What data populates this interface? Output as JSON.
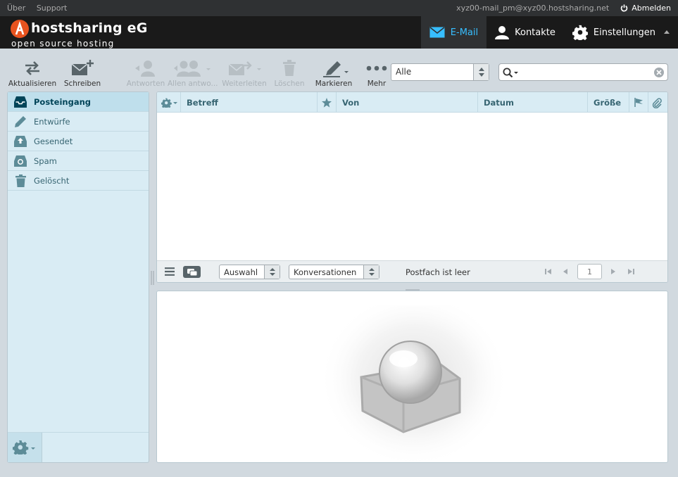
{
  "topline": {
    "links": [
      "Über",
      "Support"
    ],
    "username": "xyz00-mail_pm@xyz00.hostsharing.net",
    "logout_label": "Abmelden"
  },
  "header": {
    "brand": "hostsharing eG",
    "tagline": "open source hosting",
    "tasks": [
      {
        "label": "E-Mail",
        "icon": "mail-icon",
        "selected": true
      },
      {
        "label": "Kontakte",
        "icon": "user-icon",
        "selected": false
      },
      {
        "label": "Einstellungen",
        "icon": "gear-icon",
        "selected": false
      }
    ]
  },
  "toolbar": {
    "refresh": "Aktualisieren",
    "compose": "Schreiben",
    "reply": "Antworten",
    "reply_all": "Allen antwo...",
    "forward": "Weiterleiten",
    "delete": "Löschen",
    "mark": "Markieren",
    "more": "Mehr",
    "filter_value": "Alle",
    "search_value": ""
  },
  "folders": [
    {
      "label": "Posteingang",
      "icon": "inbox-icon",
      "selected": true
    },
    {
      "label": "Entwürfe",
      "icon": "pencil-icon",
      "selected": false
    },
    {
      "label": "Gesendet",
      "icon": "sent-icon",
      "selected": false
    },
    {
      "label": "Spam",
      "icon": "spam-icon",
      "selected": false
    },
    {
      "label": "Gelöscht",
      "icon": "trash-icon",
      "selected": false
    }
  ],
  "message_list": {
    "columns": {
      "subject": "Betreff",
      "from": "Von",
      "date": "Datum",
      "size": "Größe"
    },
    "footer": {
      "select_label": "Auswahl",
      "threads_label": "Konversationen",
      "status": "Postfach ist leer",
      "page": "1"
    }
  },
  "colors": {
    "accent": "#37beff",
    "header_bg": "#1a1a1a",
    "panel_bg": "#d9ecf4"
  }
}
